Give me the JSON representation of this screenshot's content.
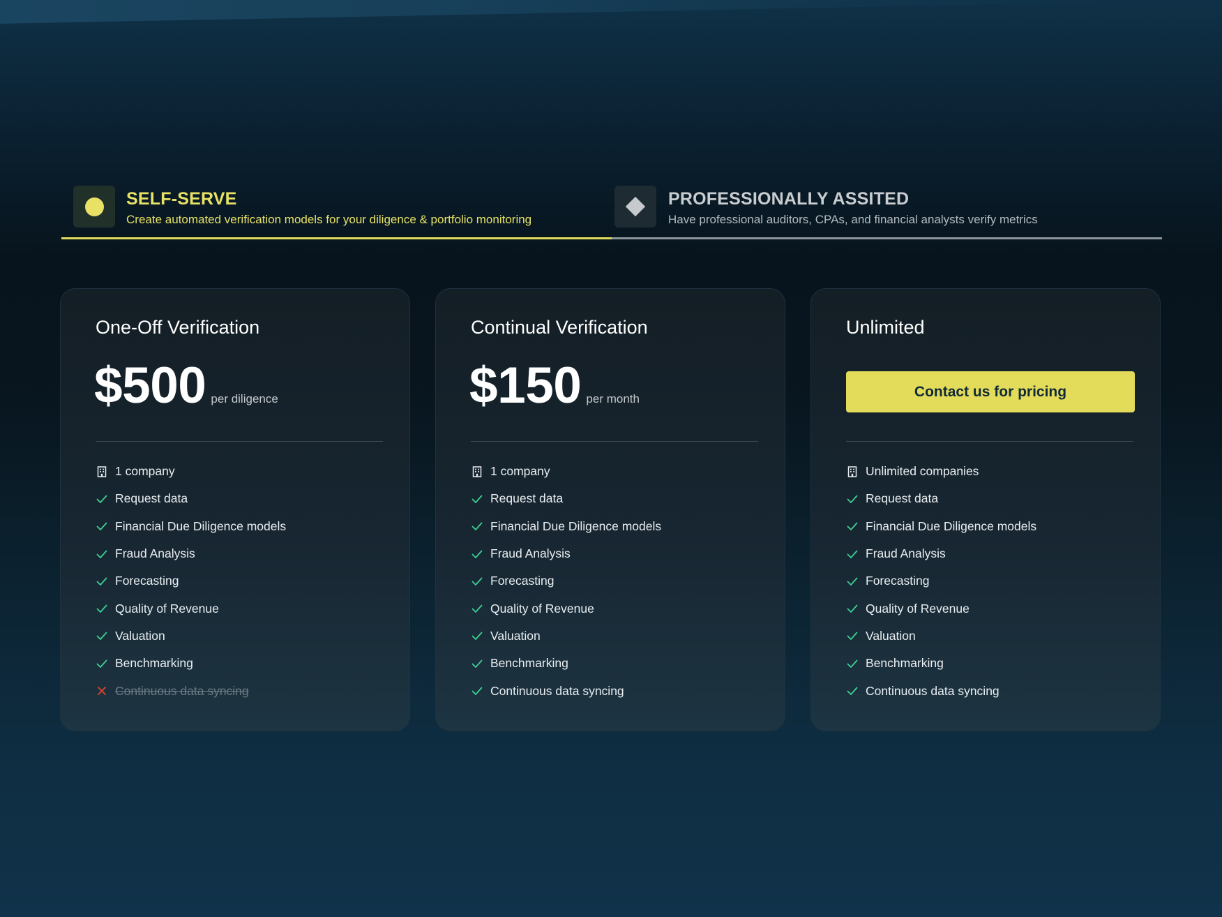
{
  "tabs": [
    {
      "title": "SELF-SERVE",
      "subtitle": "Create automated verification models for your diligence & portfolio monitoring",
      "icon": "dot-icon",
      "active": true
    },
    {
      "title": "PROFESSIONALLY ASSITED",
      "subtitle": "Have professional auditors, CPAs, and financial analysts verify metrics",
      "icon": "diamond-icon",
      "active": false
    }
  ],
  "plans": [
    {
      "name": "One-Off Verification",
      "price": "$500",
      "period": "per diligence",
      "features": [
        {
          "label": "1 company",
          "icon": "building-icon",
          "included": true
        },
        {
          "label": "Request data",
          "icon": "check-icon",
          "included": true
        },
        {
          "label": "Financial Due Diligence models",
          "icon": "check-icon",
          "included": true
        },
        {
          "label": "Fraud Analysis",
          "icon": "check-icon",
          "included": true
        },
        {
          "label": "Forecasting",
          "icon": "check-icon",
          "included": true
        },
        {
          "label": "Quality of Revenue",
          "icon": "check-icon",
          "included": true
        },
        {
          "label": "Valuation",
          "icon": "check-icon",
          "included": true
        },
        {
          "label": "Benchmarking",
          "icon": "check-icon",
          "included": true
        },
        {
          "label": "Continuous data syncing",
          "icon": "cross-icon",
          "included": false
        }
      ]
    },
    {
      "name": "Continual Verification",
      "price": "$150",
      "period": "per month",
      "features": [
        {
          "label": "1 company",
          "icon": "building-icon",
          "included": true
        },
        {
          "label": "Request data",
          "icon": "check-icon",
          "included": true
        },
        {
          "label": "Financial Due Diligence models",
          "icon": "check-icon",
          "included": true
        },
        {
          "label": "Fraud Analysis",
          "icon": "check-icon",
          "included": true
        },
        {
          "label": "Forecasting",
          "icon": "check-icon",
          "included": true
        },
        {
          "label": "Quality of Revenue",
          "icon": "check-icon",
          "included": true
        },
        {
          "label": "Valuation",
          "icon": "check-icon",
          "included": true
        },
        {
          "label": "Benchmarking",
          "icon": "check-icon",
          "included": true
        },
        {
          "label": "Continuous data syncing",
          "icon": "check-icon",
          "included": true
        }
      ]
    },
    {
      "name": "Unlimited",
      "cta_label": "Contact us for pricing",
      "features": [
        {
          "label": "Unlimited companies",
          "icon": "building-icon",
          "included": true
        },
        {
          "label": "Request data",
          "icon": "check-icon",
          "included": true
        },
        {
          "label": "Financial Due Diligence models",
          "icon": "check-icon",
          "included": true
        },
        {
          "label": "Fraud Analysis",
          "icon": "check-icon",
          "included": true
        },
        {
          "label": "Forecasting",
          "icon": "check-icon",
          "included": true
        },
        {
          "label": "Quality of Revenue",
          "icon": "check-icon",
          "included": true
        },
        {
          "label": "Valuation",
          "icon": "check-icon",
          "included": true
        },
        {
          "label": "Benchmarking",
          "icon": "check-icon",
          "included": true
        },
        {
          "label": "Continuous data syncing",
          "icon": "check-icon",
          "included": true
        }
      ]
    }
  ],
  "colors": {
    "accent": "#e3dc5b",
    "check": "#3fcf93",
    "cross": "#e0472f",
    "inactive_tab": "#8d969d"
  }
}
